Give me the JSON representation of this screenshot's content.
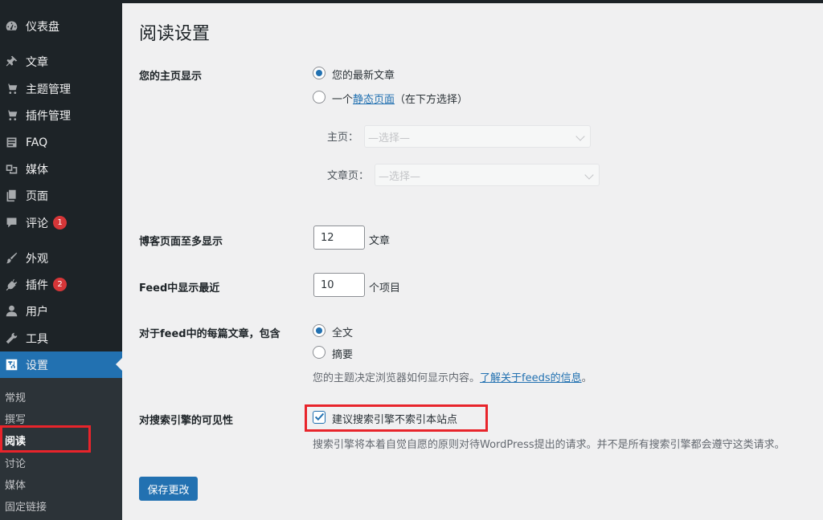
{
  "sidebar": {
    "items": [
      {
        "label": "仪表盘",
        "icon": "dashboard-icon"
      },
      {
        "label": "文章",
        "icon": "pin-icon"
      },
      {
        "label": "主题管理",
        "icon": "cart-icon"
      },
      {
        "label": "插件管理",
        "icon": "cart-icon"
      },
      {
        "label": "FAQ",
        "icon": "document-icon"
      },
      {
        "label": "媒体",
        "icon": "media-icon"
      },
      {
        "label": "页面",
        "icon": "pages-icon"
      },
      {
        "label": "评论",
        "icon": "comment-icon",
        "badge": "1"
      },
      {
        "label": "外观",
        "icon": "brush-icon"
      },
      {
        "label": "插件",
        "icon": "plugin-icon",
        "badge": "2"
      },
      {
        "label": "用户",
        "icon": "user-icon"
      },
      {
        "label": "工具",
        "icon": "wrench-icon"
      },
      {
        "label": "设置",
        "icon": "settings-icon",
        "active": true
      }
    ],
    "submenu": [
      "常规",
      "撰写",
      "阅读",
      "讨论",
      "媒体",
      "固定链接"
    ],
    "current_submenu": "阅读"
  },
  "page": {
    "title": "阅读设置",
    "homepage": {
      "label": "您的主页显示",
      "option_latest": "您的最新文章",
      "option_static_prefix": "一个",
      "option_static_link": "静态页面",
      "option_static_suffix": "（在下方选择）",
      "selected": "latest",
      "front_label": "主页：",
      "front_value": "—选择—",
      "posts_label": "文章页：",
      "posts_value": "—选择—"
    },
    "posts_per_page": {
      "label": "博客页面至多显示",
      "value": "12",
      "unit": "文章"
    },
    "feed_items": {
      "label": "Feed中显示最近",
      "value": "10",
      "unit": "个项目"
    },
    "feed_content": {
      "label": "对于feed中的每篇文章，包含",
      "option_full": "全文",
      "option_summary": "摘要",
      "selected": "full",
      "desc_prefix": "您的主题决定浏览器如何显示内容。",
      "desc_link": "了解关于feeds的信息",
      "desc_suffix": "。"
    },
    "search_visibility": {
      "label": "对搜索引擎的可见性",
      "checkbox_label": "建议搜索引擎不索引本站点",
      "checked": true,
      "desc": "搜索引擎将本着自觉自愿的原则对待WordPress提出的请求。并不是所有搜索引擎都会遵守这类请求。"
    },
    "save_label": "保存更改"
  },
  "colors": {
    "accent": "#2271b1",
    "highlight": "#e8242b",
    "sidebar_bg": "#1d2327"
  }
}
